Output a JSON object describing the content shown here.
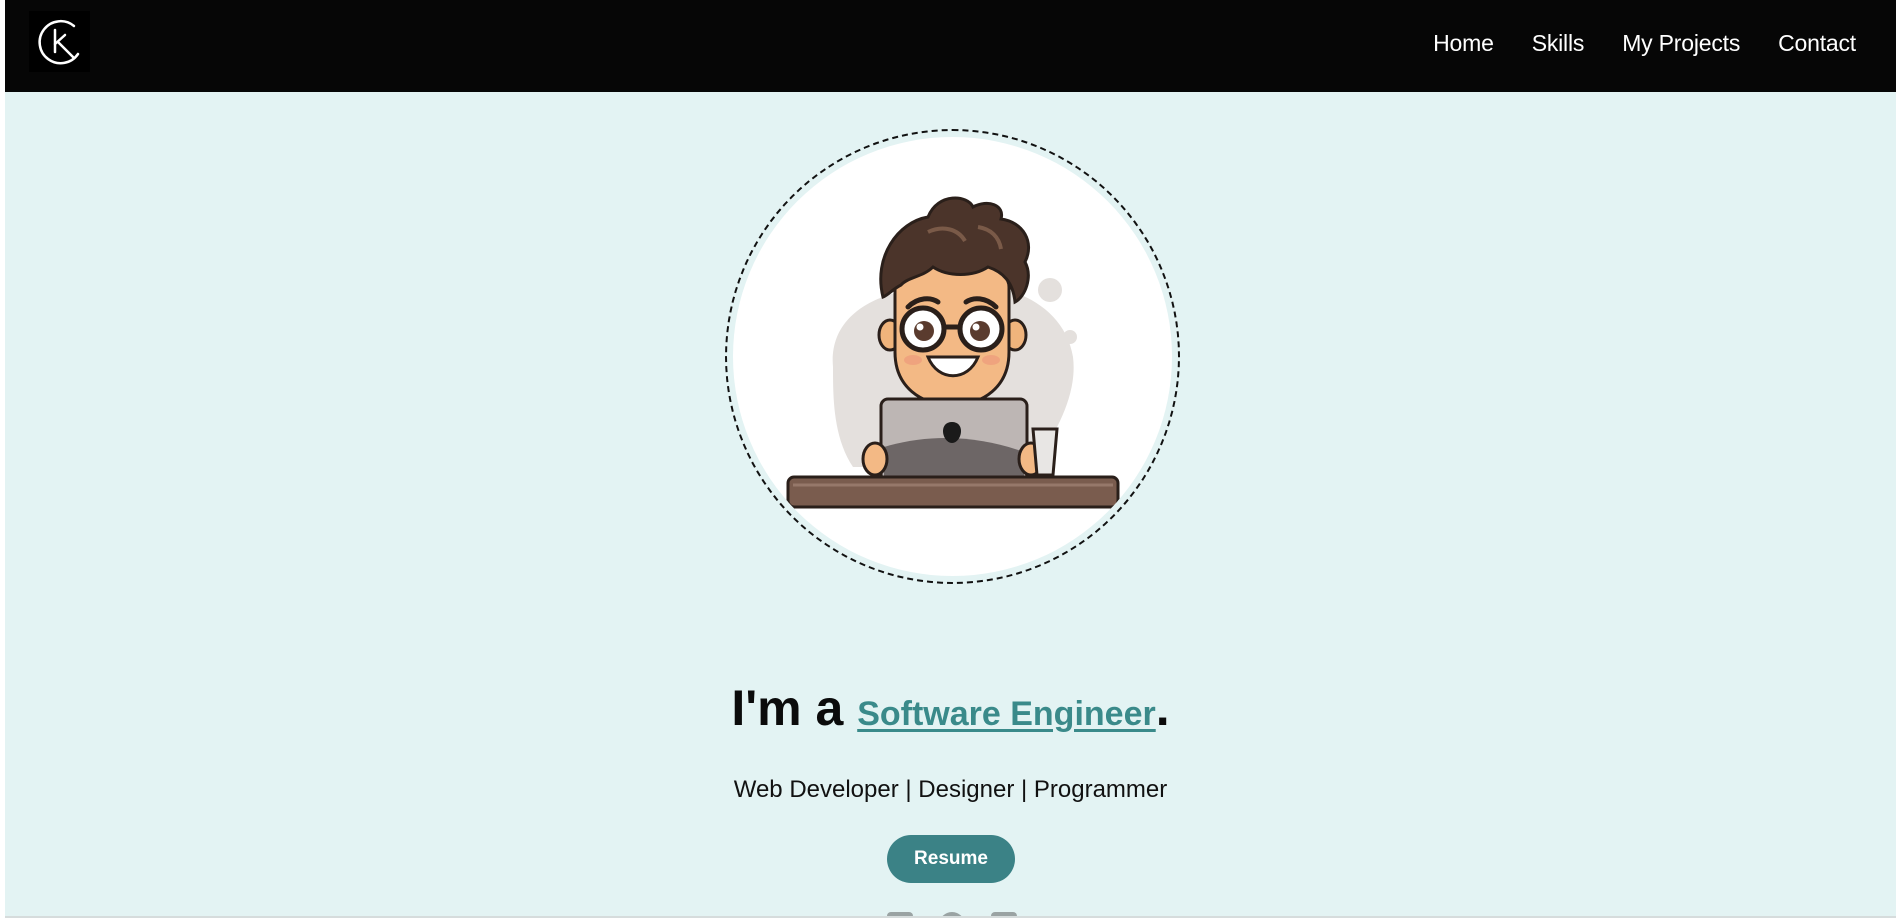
{
  "nav": {
    "logo_icon": "ck-monogram-logo",
    "links": [
      "Home",
      "Skills",
      "My Projects",
      "Contact"
    ]
  },
  "hero": {
    "avatar_icon": "developer-cartoon-illustration",
    "prefix": "I'm a ",
    "role": "Software Engineer",
    "suffix": ".",
    "subtitle": "Web Developer | Designer | Programmer",
    "resume_label": "Resume"
  },
  "socials": {
    "icons": [
      "linkedin-icon",
      "github-icon",
      "mail-icon"
    ]
  },
  "colors": {
    "navbar": "#060606",
    "page_background": "#e3f3f3",
    "accent": "#3b8286"
  }
}
